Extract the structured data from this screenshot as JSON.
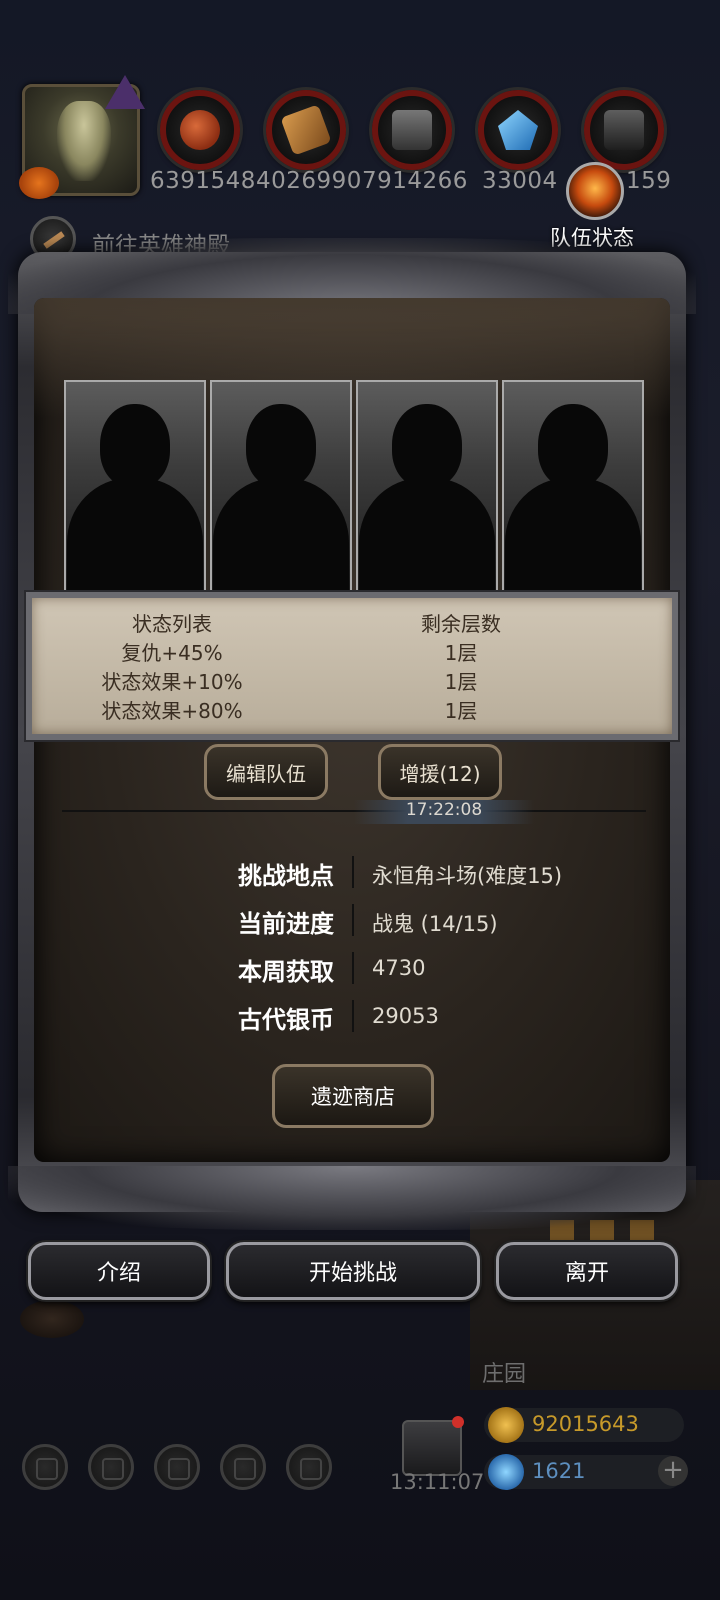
{
  "resources": [
    {
      "icon": "meat-icon",
      "value": "6391548"
    },
    {
      "icon": "wood-icon",
      "value": "4026990"
    },
    {
      "icon": "iron-icon",
      "value": "7914266"
    },
    {
      "icon": "crystal-icon",
      "value": "33004"
    },
    {
      "icon": "steel-icon",
      "value": "159"
    }
  ],
  "nav": {
    "hero_hall": "前往英雄神殿",
    "team_status": "队伍状态"
  },
  "status_table": {
    "header": {
      "name": "状态列表",
      "stacks": "剩余层数"
    },
    "rows": [
      {
        "name": "复仇+45%",
        "stacks": "1层"
      },
      {
        "name": "状态效果+10%",
        "stacks": "1层"
      },
      {
        "name": "状态效果+80%",
        "stacks": "1层"
      }
    ]
  },
  "buttons": {
    "edit_team": "编辑队伍",
    "reinforce": "增援(12)",
    "reinforce_timer": "17:22:08",
    "shop": "遗迹商店",
    "intro": "介绍",
    "start": "开始挑战",
    "leave": "离开"
  },
  "info": [
    {
      "label": "挑战地点",
      "value": "永恒角斗场(难度15)"
    },
    {
      "label": "当前进度",
      "value": "战鬼 (14/15)"
    },
    {
      "label": "本周获取",
      "value": "4730"
    },
    {
      "label": "古代银币",
      "value": "29053"
    }
  ],
  "hud": {
    "estate": "庄园",
    "gift_timer": "13:11:07",
    "gold": "92015643",
    "gems": "1621",
    "plus": "+"
  },
  "colors": {
    "gold_text": "#c79a2a",
    "gem_text": "#5d8fbf",
    "resource_ring": "#6b1410"
  }
}
